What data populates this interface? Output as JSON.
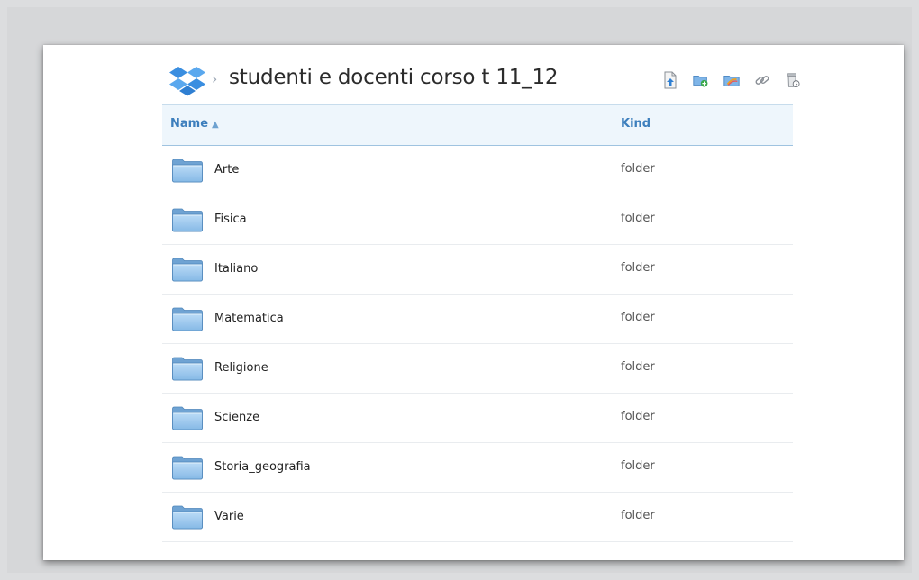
{
  "header": {
    "breadcrumb_separator": "›",
    "folder_title": "studenti e docenti corso t 11_12",
    "toolbar": [
      {
        "name": "upload-icon",
        "label": "Upload"
      },
      {
        "name": "new-folder-icon",
        "label": "New folder"
      },
      {
        "name": "share-folder-icon",
        "label": "Share folder"
      },
      {
        "name": "link-icon",
        "label": "Share link"
      },
      {
        "name": "deleted-files-icon",
        "label": "Show deleted files"
      }
    ]
  },
  "table": {
    "columns": {
      "name": "Name",
      "kind": "Kind"
    },
    "sort_indicator": "▲",
    "rows": [
      {
        "name": "Arte",
        "kind": "folder"
      },
      {
        "name": "Fisica",
        "kind": "folder"
      },
      {
        "name": "Italiano",
        "kind": "folder"
      },
      {
        "name": "Matematica",
        "kind": "folder"
      },
      {
        "name": "Religione",
        "kind": "folder"
      },
      {
        "name": "Scienze",
        "kind": "folder"
      },
      {
        "name": "Storia_geografia",
        "kind": "folder"
      },
      {
        "name": "Varie",
        "kind": "folder"
      }
    ]
  },
  "colors": {
    "accent": "#3d7fbd",
    "header_bg": "#eef6fc",
    "folder_blue": "#9cc6ec"
  }
}
